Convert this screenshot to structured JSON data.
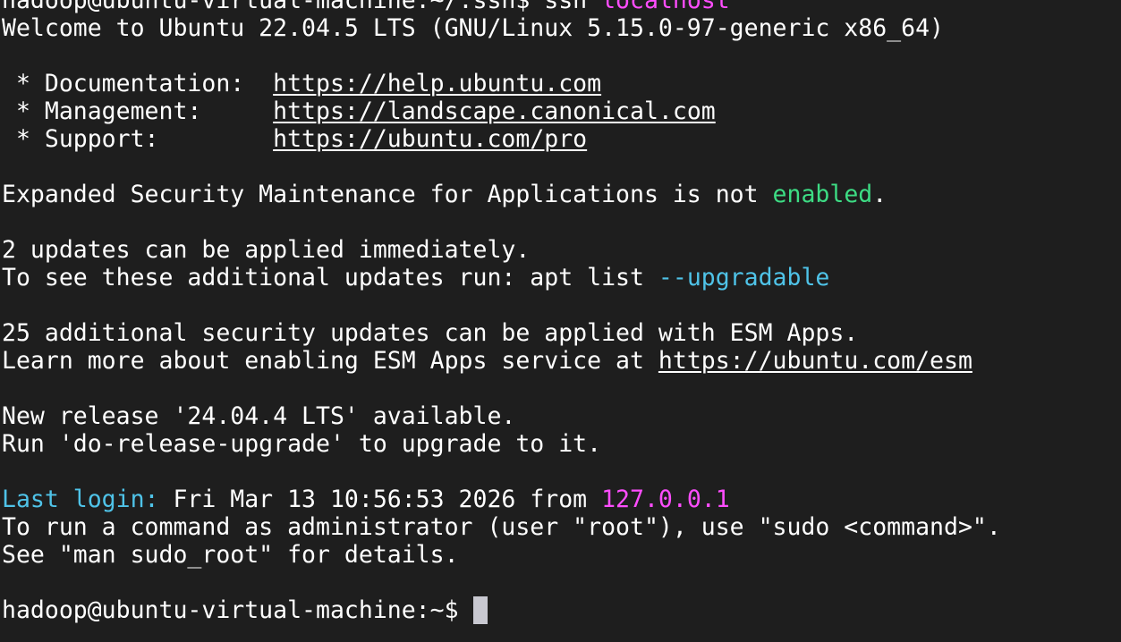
{
  "terminal": {
    "line1": {
      "prompt": "hadoop@ubuntu-virtual-machine:~/.ssh$ ",
      "cmd": "ssh ",
      "host": "localhost"
    },
    "welcome": "Welcome to Ubuntu 22.04.5 LTS (GNU/Linux 5.15.0-97-generic x86_64)",
    "doc_label": " * Documentation:  ",
    "doc_url": "https://help.ubuntu.com",
    "mgmt_label": " * Management:     ",
    "mgmt_url": "https://landscape.canonical.com",
    "support_label": " * Support:        ",
    "support_url": "https://ubuntu.com/pro",
    "esm_text": "Expanded Security Maintenance for Applications is not ",
    "esm_status": "enabled",
    "esm_end": ".",
    "updates_count": "2 updates can be applied immediately.",
    "updates_cmd_prefix": "To see these additional updates run: apt list ",
    "updates_cmd_flag": "--upgradable",
    "security_updates": "25 additional security updates can be applied with ESM Apps.",
    "learn_more_prefix": "Learn more about enabling ESM Apps service at ",
    "learn_more_url": "https://ubuntu.com/esm",
    "new_release": "New release '24.04.4 LTS' available.",
    "run_upgrade": "Run 'do-release-upgrade' to upgrade to it.",
    "last_login_label": "Last login:",
    "last_login_time": " Fri Mar 13 10:56:53 2026 from ",
    "last_login_ip": "127.0.0.1",
    "sudo_hint": "To run a command as administrator (user \"root\"), use \"sudo <command>\".",
    "man_hint": "See \"man sudo_root\" for details.",
    "final_prompt": "hadoop@ubuntu-virtual-machine:~$ "
  }
}
